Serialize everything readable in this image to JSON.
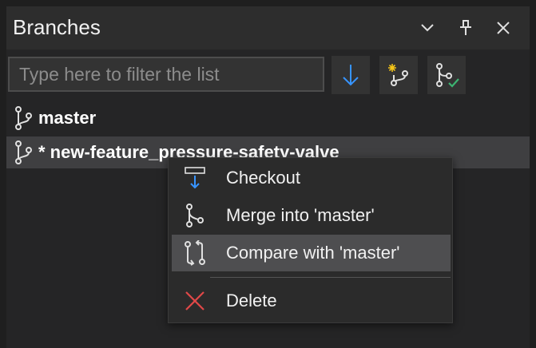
{
  "window": {
    "title": "Branches",
    "controls": [
      "chevron-down",
      "pin",
      "close"
    ]
  },
  "toolbar": {
    "filter_placeholder": "Type here to filter the list",
    "buttons": [
      "fetch-down-arrow",
      "new-branch",
      "checkout-branch-check"
    ]
  },
  "branches": [
    {
      "label": "master",
      "current": false
    },
    {
      "label": "* new-feature_pressure-safety-valve",
      "current": true
    }
  ],
  "context_menu": {
    "items": [
      {
        "label": "Checkout",
        "icon": "checkout-icon"
      },
      {
        "label": "Merge into 'master'",
        "icon": "merge-icon"
      },
      {
        "label": "Compare with 'master'",
        "icon": "compare-icon",
        "highlighted": true
      },
      {
        "label": "Delete",
        "icon": "delete-icon"
      }
    ]
  },
  "colors": {
    "background": "#252526",
    "accent_blue": "#3794ff",
    "delete_red": "#e04848",
    "check_green": "#3cb371",
    "new_yellow": "#f5c518"
  }
}
